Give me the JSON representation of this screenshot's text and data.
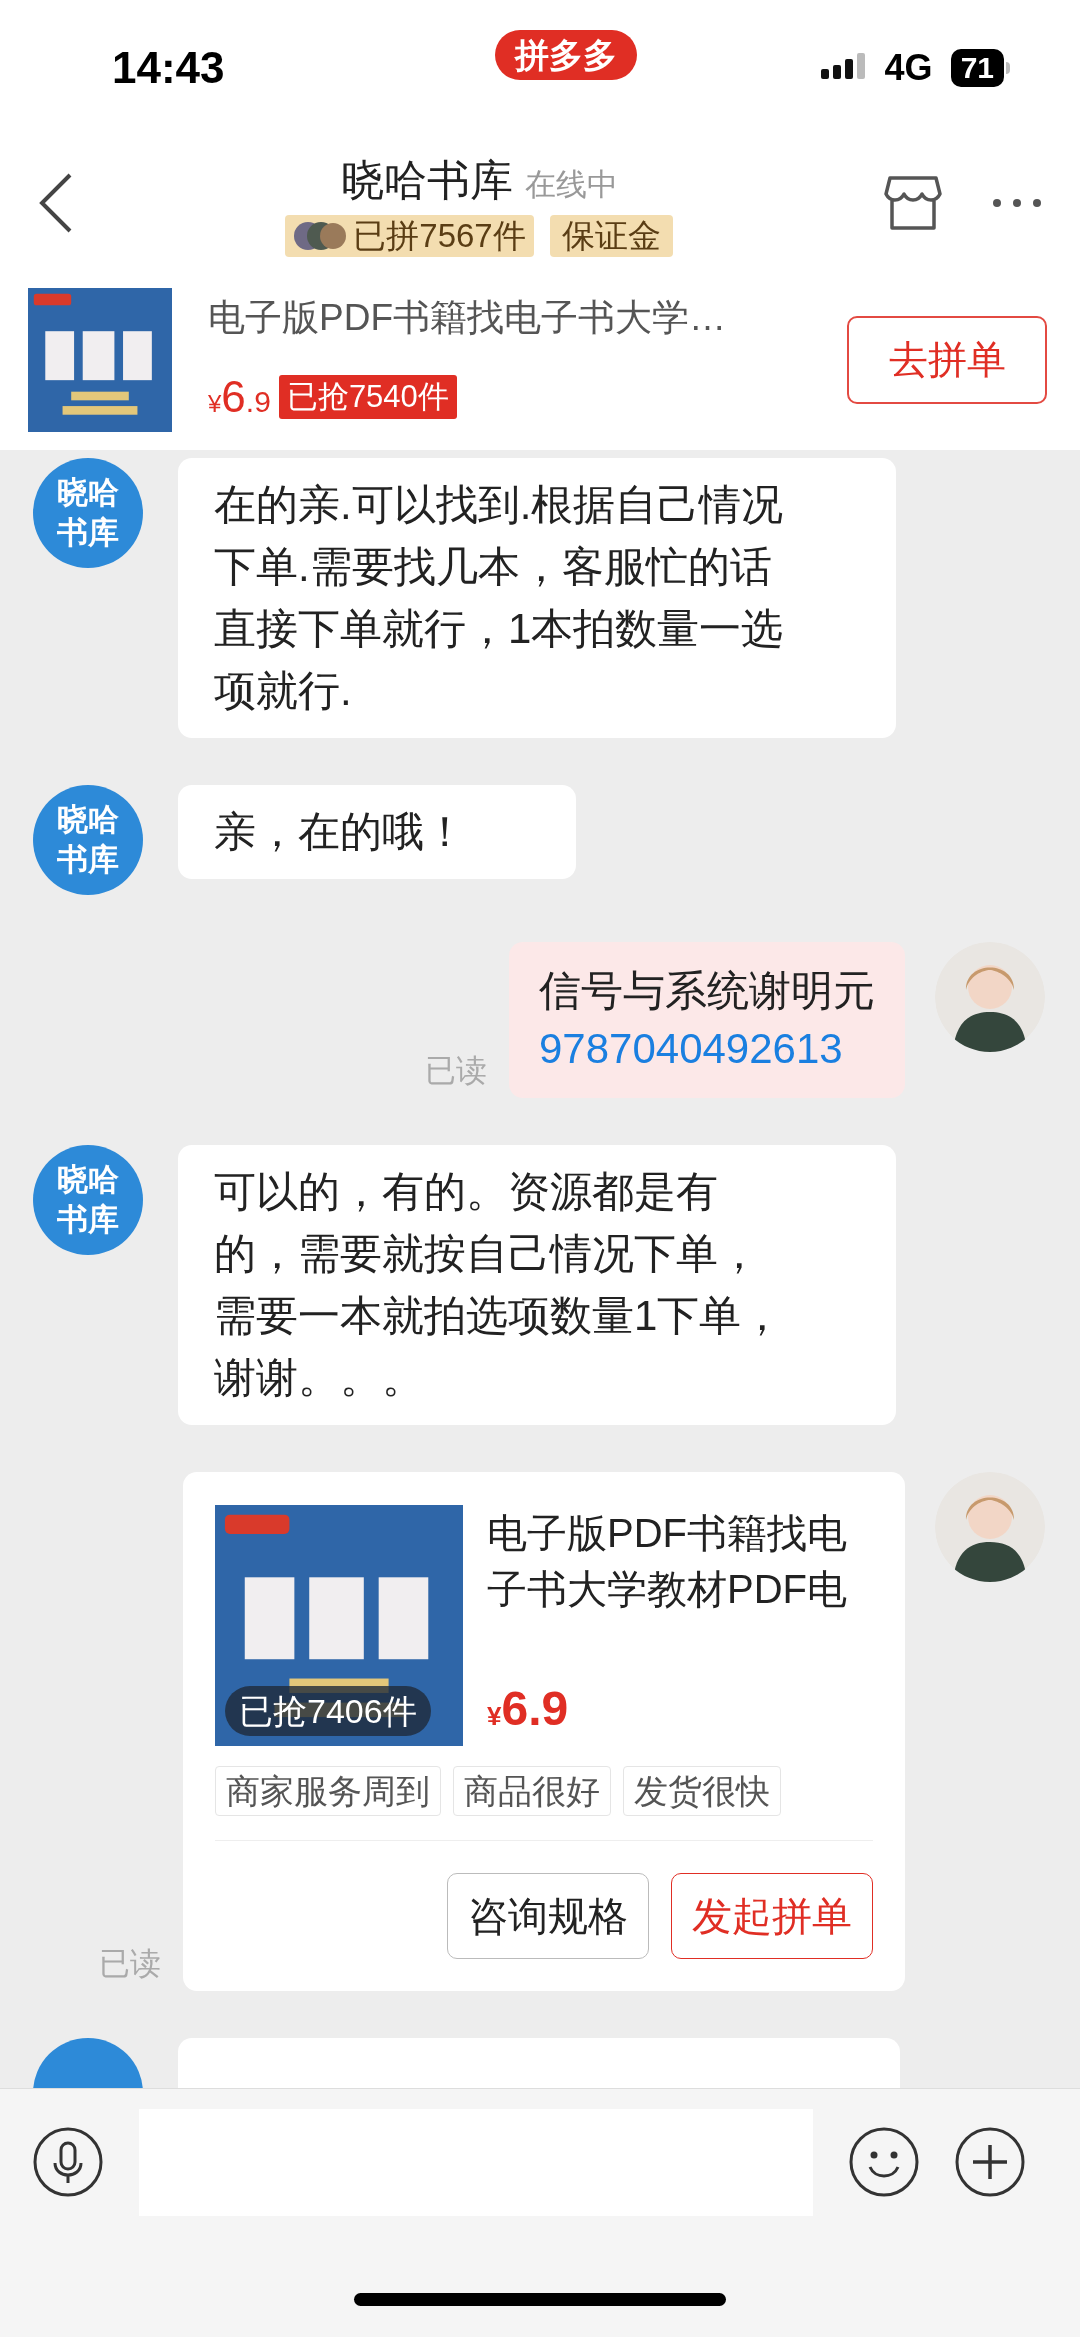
{
  "status_bar": {
    "time": "14:43",
    "app_badge": "拼多多",
    "network": "4G",
    "battery": "71"
  },
  "header": {
    "title": "晓哈书库",
    "presence": "在线中",
    "stats_badge": "已拼7567件",
    "deposit_badge": "保证金"
  },
  "product_bar": {
    "title": "电子版PDF书籍找电子书大学…",
    "currency": "¥",
    "price_int": "6",
    "price_dec": ".9",
    "sold": "已抢7540件",
    "button": "去拼单"
  },
  "messages": [
    {
      "kind": "text",
      "outgoing": false,
      "avatar": "晓哈书库",
      "text": "在的亲.可以找到.根据自己情况下单.需要找几本，客服忙的话直接下单就行，1本拍数量一选项就行."
    },
    {
      "kind": "text",
      "outgoing": false,
      "avatar": "晓哈书库",
      "text": "亲，在的哦！"
    },
    {
      "kind": "text",
      "outgoing": true,
      "text": "信号与系统谢明元",
      "link": "9787040492613",
      "receipt": "已读"
    },
    {
      "kind": "text",
      "outgoing": false,
      "avatar": "晓哈书库",
      "text": "可以的，有的。资源都是有的，需要就按自己情况下单，需要一本就拍选项数量1下单，谢谢。。。"
    },
    {
      "kind": "product",
      "outgoing": true,
      "title": "电子版PDF书籍找电子书大学教材PDF电",
      "sold": "已抢7406件",
      "currency": "¥",
      "price": "6.9",
      "tags": [
        "商家服务周到",
        "商品很好",
        "发货很快"
      ],
      "buttons": [
        {
          "label": "咨询规格",
          "kind": "plain"
        },
        {
          "label": "发起拼单",
          "kind": "primary"
        }
      ],
      "receipt": "已读"
    },
    {
      "kind": "partial",
      "outgoing": false
    }
  ]
}
